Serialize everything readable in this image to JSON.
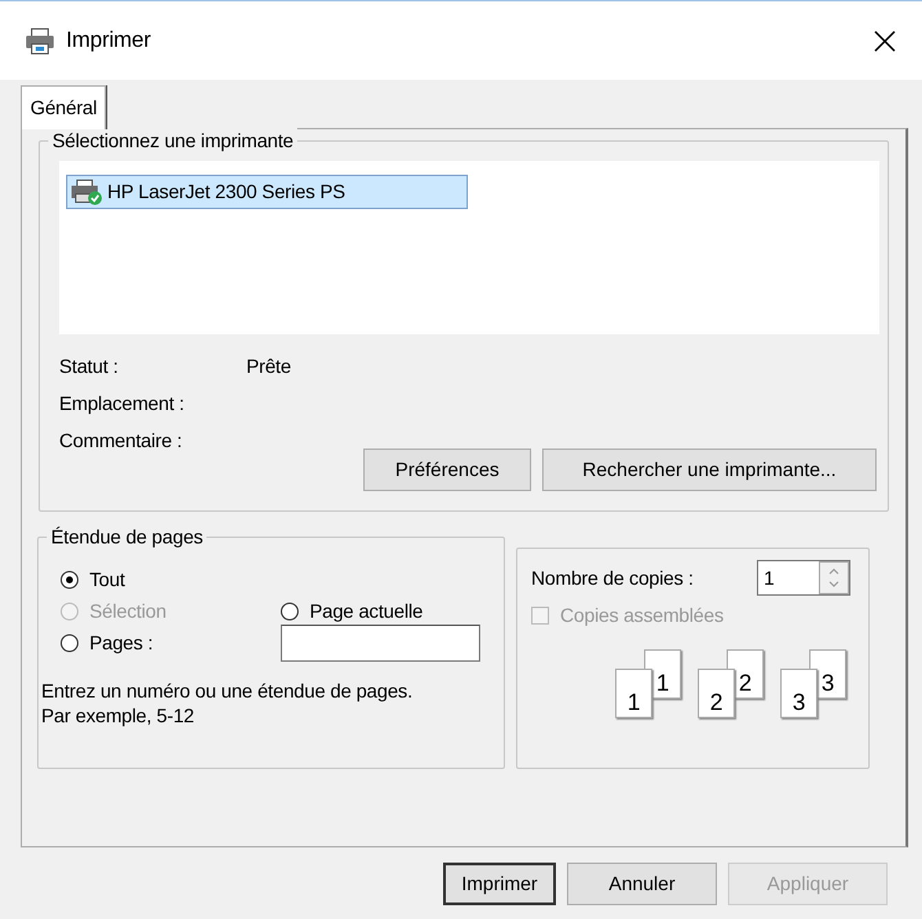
{
  "window": {
    "title": "Imprimer"
  },
  "tabs": [
    {
      "label": "Général",
      "selected": true
    }
  ],
  "printer_group": {
    "legend": "Sélectionnez une imprimante",
    "printers": [
      {
        "name": "HP LaserJet 2300 Series PS",
        "selected": true
      }
    ],
    "fields": [
      {
        "label": "Statut :",
        "value": "Prête"
      },
      {
        "label": "Emplacement :"
      },
      {
        "label": "Commentaire :"
      }
    ],
    "buttons": [
      "Préférences",
      "Rechercher une imprimante..."
    ]
  },
  "page_range": {
    "legend": "Étendue de pages",
    "options": [
      {
        "label": "Tout",
        "selected": true,
        "disabled": false
      },
      {
        "label": "Sélection",
        "selected": false,
        "disabled": true
      },
      {
        "label": "Page actuelle",
        "selected": false,
        "disabled": false
      },
      {
        "label": "Pages :",
        "selected": false,
        "disabled": false
      }
    ],
    "hint": "Entrez un numéro ou une étendue de pages.\nPar exemple, 5-12"
  },
  "copies": {
    "label": "Nombre de copies :",
    "value": "1",
    "collate": {
      "label": "Copies assemblées",
      "checked": false,
      "disabled": true
    },
    "preview": [
      {
        "front": "1",
        "back": "1"
      },
      {
        "front": "2",
        "back": "2"
      },
      {
        "front": "3",
        "back": "3"
      }
    ]
  },
  "buttons": [
    {
      "label": "Imprimer",
      "default": true,
      "disabled": false
    },
    {
      "label": "Annuler",
      "default": false,
      "disabled": false
    },
    {
      "label": "Appliquer",
      "default": false,
      "disabled": true
    }
  ]
}
